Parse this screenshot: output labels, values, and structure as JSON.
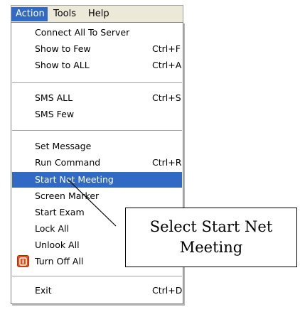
{
  "menubar": {
    "items": [
      "Action",
      "Tools",
      "Help"
    ]
  },
  "menu": {
    "items": [
      {
        "label": "Connect All To Server",
        "shortcut": ""
      },
      {
        "label": "Show to Few",
        "shortcut": "Ctrl+F"
      },
      {
        "label": "Show to ALL",
        "shortcut": "Ctrl+A"
      },
      {
        "label": "SMS ALL",
        "shortcut": "Ctrl+S"
      },
      {
        "label": "SMS Few",
        "shortcut": ""
      },
      {
        "label": "Set Message",
        "shortcut": ""
      },
      {
        "label": "Run Command",
        "shortcut": "Ctrl+R"
      },
      {
        "label": "Start Net Meeting",
        "shortcut": ""
      },
      {
        "label": "Screen Marker",
        "shortcut": ""
      },
      {
        "label": "Start Exam",
        "shortcut": ""
      },
      {
        "label": "Lock All",
        "shortcut": ""
      },
      {
        "label": "Unlook  All",
        "shortcut": ""
      },
      {
        "label": "Turn Off All",
        "shortcut": ""
      },
      {
        "label": "Exit",
        "shortcut": "Ctrl+D"
      }
    ],
    "selected_item": "Start Net Meeting",
    "selection_color": "#316ac5",
    "turn_off_icon": "power-icon"
  },
  "callout": {
    "line1": "Select Start Net",
    "line2": "Meeting"
  }
}
